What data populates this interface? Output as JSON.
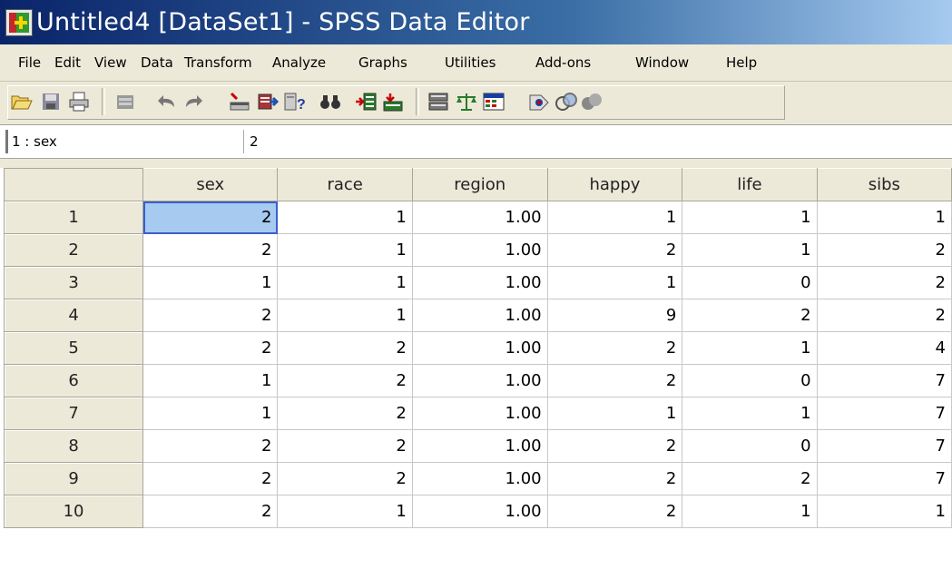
{
  "window": {
    "title": "Untitled4 [DataSet1] - SPSS Data Editor",
    "app_icon": "spss-app-icon"
  },
  "menu": [
    "File",
    "Edit",
    "View",
    "Data",
    "Transform",
    "Analyze",
    "Graphs",
    "Utilities",
    "Add-ons",
    "Window",
    "Help"
  ],
  "toolbar": {
    "buttons": [
      "open-folder-icon",
      "save-icon",
      "print-icon",
      "dialog-recall-icon",
      "undo-icon",
      "redo-icon",
      "goto-case-icon",
      "variables-icon",
      "find-binoculars-icon",
      "insert-cases-icon",
      "insert-variable-icon",
      "split-file-icon",
      "weight-cases-icon",
      "select-cases-icon",
      "value-labels-icon",
      "use-sets-icon",
      "show-all-variables-icon"
    ]
  },
  "cell_editor": {
    "reference": "1 : sex",
    "value": "2"
  },
  "grid": {
    "columns": [
      "sex",
      "race",
      "region",
      "happy",
      "life",
      "sibs"
    ],
    "rows": [
      {
        "n": "1",
        "cells": [
          "2",
          "1",
          "1.00",
          "1",
          "1",
          "1"
        ]
      },
      {
        "n": "2",
        "cells": [
          "2",
          "1",
          "1.00",
          "2",
          "1",
          "2"
        ]
      },
      {
        "n": "3",
        "cells": [
          "1",
          "1",
          "1.00",
          "1",
          "0",
          "2"
        ]
      },
      {
        "n": "4",
        "cells": [
          "2",
          "1",
          "1.00",
          "9",
          "2",
          "2"
        ]
      },
      {
        "n": "5",
        "cells": [
          "2",
          "2",
          "1.00",
          "2",
          "1",
          "4"
        ]
      },
      {
        "n": "6",
        "cells": [
          "1",
          "2",
          "1.00",
          "2",
          "0",
          "7"
        ]
      },
      {
        "n": "7",
        "cells": [
          "1",
          "2",
          "1.00",
          "1",
          "1",
          "7"
        ]
      },
      {
        "n": "8",
        "cells": [
          "2",
          "2",
          "1.00",
          "2",
          "0",
          "7"
        ]
      },
      {
        "n": "9",
        "cells": [
          "2",
          "2",
          "1.00",
          "2",
          "2",
          "7"
        ]
      },
      {
        "n": "10",
        "cells": [
          "2",
          "1",
          "1.00",
          "2",
          "1",
          "1"
        ]
      }
    ],
    "selected_cell": {
      "row": "1",
      "column": "sex"
    },
    "selection_color": "#a6caf0"
  }
}
